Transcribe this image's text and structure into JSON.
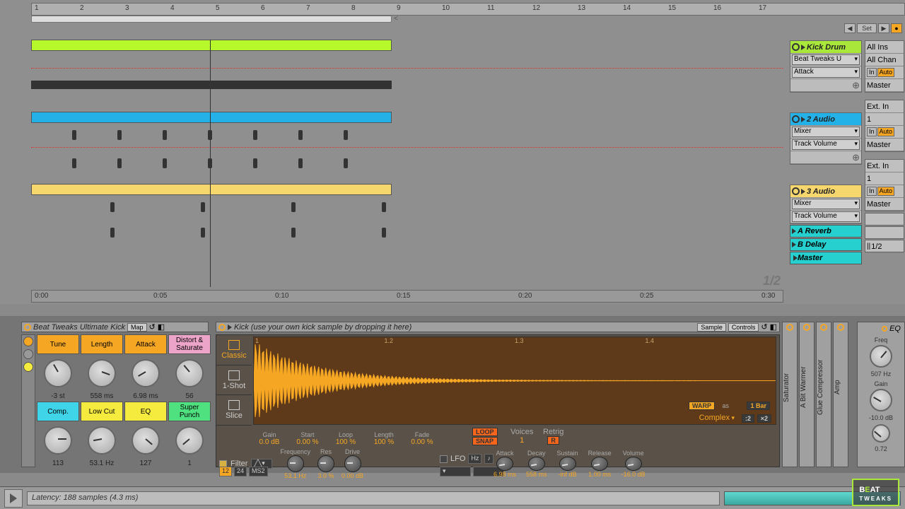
{
  "ruler_bars": [
    "1",
    "2",
    "3",
    "4",
    "5",
    "6",
    "7",
    "8",
    "9",
    "10",
    "11",
    "12",
    "13",
    "14",
    "15",
    "16",
    "17"
  ],
  "time_ruler": [
    "0:00",
    "0:05",
    "0:10",
    "0:15",
    "0:20",
    "0:25",
    "0:30"
  ],
  "zoom": "1/2",
  "top_set": "Set",
  "tracks": [
    {
      "name": "Kick Drum",
      "color": "green",
      "rows": [
        "Beat Tweaks U",
        "Attack"
      ],
      "io": {
        "in": "All Ins",
        "ch": "All Chan",
        "btn_in": "In",
        "btn_auto": "Auto",
        "out": "Master"
      }
    },
    {
      "name": "2 Audio",
      "color": "blue",
      "rows": [
        "Mixer",
        "Track Volume"
      ],
      "io": {
        "in": "Ext. In",
        "ch": "1",
        "btn_in": "In",
        "btn_auto": "Auto",
        "out": "Master"
      }
    },
    {
      "name": "3 Audio",
      "color": "yellow",
      "rows": [
        "Mixer",
        "Track Volume"
      ],
      "io": {
        "in": "Ext. In",
        "ch": "1",
        "btn_in": "In",
        "btn_auto": "Auto",
        "out": "Master"
      }
    }
  ],
  "returns": [
    "A Reverb",
    "B Delay"
  ],
  "master": {
    "label": "Master",
    "io": "1/2"
  },
  "device_rack": {
    "title": "Beat Tweaks Ultimate Kick",
    "map": "Map",
    "knobs": [
      {
        "label": "Tune",
        "color": "orange",
        "val": "-3 st",
        "rot": -30
      },
      {
        "label": "Length",
        "color": "orange",
        "val": "558 ms",
        "rot": 110
      },
      {
        "label": "Attack",
        "color": "orange",
        "val": "6.98 ms",
        "rot": -120
      },
      {
        "label": "Distort & Saturate",
        "color": "pink",
        "val": "56",
        "rot": -40
      },
      {
        "label": "Comp.",
        "color": "cyan",
        "val": "113",
        "rot": 90
      },
      {
        "label": "Low Cut",
        "color": "yellow",
        "val": "53.1 Hz",
        "rot": -100
      },
      {
        "label": "EQ",
        "color": "yellow",
        "val": "127",
        "rot": 130
      },
      {
        "label": "Super Punch",
        "color": "green",
        "val": "1",
        "rot": -130
      }
    ]
  },
  "simpler": {
    "title": "Kick (use your own kick sample by dropping it here)",
    "tabs": {
      "sample": "Sample",
      "controls": "Controls"
    },
    "modes": [
      "Classic",
      "1-Shot",
      "Slice"
    ],
    "wave_markers": [
      "1",
      "1.2",
      "1.3",
      "1.4"
    ],
    "params1": [
      {
        "l": "Gain",
        "v": "0.0 dB"
      },
      {
        "l": "Start",
        "v": "0.00 %"
      },
      {
        "l": "Loop",
        "v": "100 %"
      },
      {
        "l": "Length",
        "v": "100 %"
      },
      {
        "l": "Fade",
        "v": "0.00 %"
      }
    ],
    "loop": "LOOP",
    "snap": "SNAP",
    "voices_l": "Voices",
    "voices_v": "1",
    "retrig": "Retrig",
    "r": "R",
    "warp": "WARP",
    "bars": "1 Bar",
    "as": "as",
    "complex": "Complex",
    "half": ":2",
    "dbl": "×2",
    "filter": {
      "on": true,
      "label": "Filter",
      "type": "MS2",
      "t12": "12",
      "t24": "24",
      "params": [
        {
          "l": "Frequency",
          "v": "53.1 Hz"
        },
        {
          "l": "Res",
          "v": "3.0 %"
        },
        {
          "l": "Drive",
          "v": "0.00 dB"
        }
      ]
    },
    "lfo": {
      "label": "LFO",
      "hz": "Hz"
    },
    "adsr": [
      {
        "l": "Attack",
        "v": "6.98 ms"
      },
      {
        "l": "Decay",
        "v": "558 ms"
      },
      {
        "l": "Sustain",
        "v": "-inf dB"
      },
      {
        "l": "Release",
        "v": "1.00 ms"
      },
      {
        "l": "Volume",
        "v": "-16.0 dB"
      }
    ]
  },
  "side_devices": [
    "Saturator",
    "A Bit Warmer",
    "Glue Compressor",
    "Amp"
  ],
  "eq": {
    "title": "EQ",
    "freq_l": "Freq",
    "freq_v": "507 Hz",
    "gain_l": "Gain",
    "gain_v": "-10.0 dB",
    "q_v": "0.72"
  },
  "status": "Latency: 188 samples (4.3 ms)",
  "logo": {
    "a": "B",
    "b": "E",
    "c": "AT",
    "sub": "TWEAKS"
  }
}
